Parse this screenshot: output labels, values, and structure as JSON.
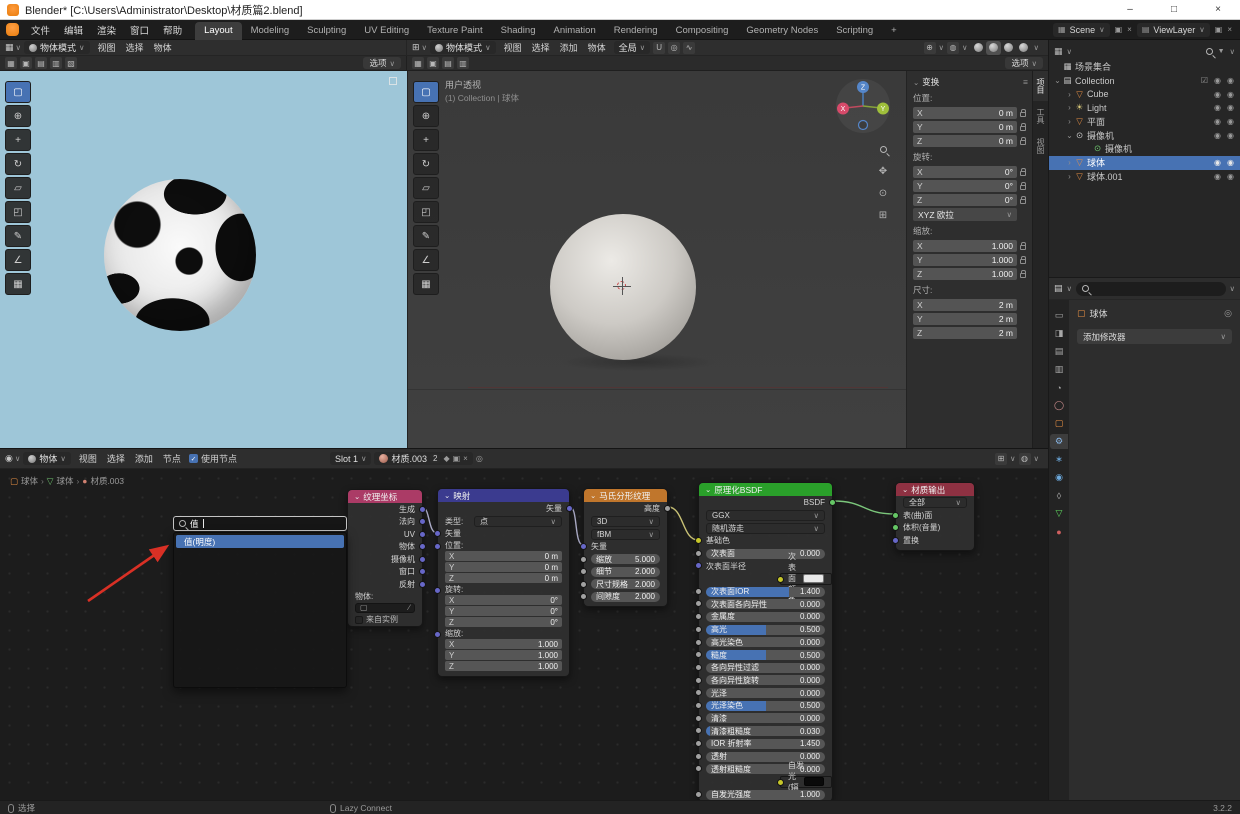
{
  "titlebar": {
    "title": "Blender* [C:\\Users\\Administrator\\Desktop\\材质篇2.blend]",
    "minimize": "–",
    "maximize": "□",
    "close": "×"
  },
  "glyphs": {
    "chevron": "∨",
    "caret": "⌄",
    "collapse": "›",
    "sep": "›",
    "funnel": "▼",
    "menu": "≡",
    "pin": "◎",
    "check": "✓",
    "x": "×",
    "box": "▦",
    "layers": "▤",
    "grid": "⊞",
    "camera": "⊙",
    "hand": "✥",
    "eyedropper": "∕",
    "shield": "◆",
    "copy": "▣",
    "obj": "▢",
    "dot": "●"
  },
  "colors": {
    "accent": "#4772b3",
    "selection": "#4772b3",
    "socket_vector": "#6767c7",
    "socket_color": "#c7c729",
    "socket_float": "#a1a1a1",
    "socket_shader": "#65c765"
  },
  "topbar": {
    "menus": [
      "文件",
      "编辑",
      "渲染",
      "窗口",
      "帮助"
    ],
    "tabs": [
      {
        "label": "Layout",
        "active": true
      },
      {
        "label": "Modeling"
      },
      {
        "label": "Sculpting"
      },
      {
        "label": "UV Editing"
      },
      {
        "label": "Texture Paint"
      },
      {
        "label": "Shading"
      },
      {
        "label": "Animation"
      },
      {
        "label": "Rendering"
      },
      {
        "label": "Compositing"
      },
      {
        "label": "Geometry Nodes"
      },
      {
        "label": "Scripting"
      },
      {
        "label": "+"
      }
    ],
    "scene_label": "Scene",
    "viewlayer_label": "ViewLayer"
  },
  "viewport_left": {
    "mode": "物体模式",
    "menus": [
      "视图",
      "选择",
      "物体"
    ],
    "options": "选项",
    "tools": [
      {
        "g": "▢",
        "active": true
      },
      {
        "g": "⊕"
      },
      {
        "g": "+"
      },
      {
        "g": "↻"
      },
      {
        "g": "▱"
      },
      {
        "g": "◰"
      },
      {
        "g": "✎"
      },
      {
        "g": "∠"
      },
      {
        "g": "▦"
      }
    ]
  },
  "viewport_center": {
    "mode": "物体模式",
    "menus": [
      "视图",
      "选择",
      "添加",
      "物体"
    ],
    "orientation": "全局",
    "options": "选项",
    "view_label": "用户透视",
    "context_label": "(1) Collection | 球体",
    "axis_x": "X",
    "axis_y": "Y",
    "axis_z": "Z",
    "shading": [
      {},
      {
        "active": true
      },
      {},
      {}
    ]
  },
  "npanel": {
    "title": "变换",
    "tabs": [
      {
        "label": "项目",
        "active": true
      },
      {
        "label": "工具"
      },
      {
        "label": "视图"
      }
    ],
    "location": {
      "label": "位置:",
      "rows": [
        {
          "a": "X",
          "v": "0 m"
        },
        {
          "a": "Y",
          "v": "0 m"
        },
        {
          "a": "Z",
          "v": "0 m"
        }
      ]
    },
    "rotation": {
      "label": "旋转:",
      "mode": "XYZ 欧拉",
      "rows": [
        {
          "a": "X",
          "v": "0°"
        },
        {
          "a": "Y",
          "v": "0°"
        },
        {
          "a": "Z",
          "v": "0°"
        }
      ]
    },
    "scale": {
      "label": "缩放:",
      "rows": [
        {
          "a": "X",
          "v": "1.000"
        },
        {
          "a": "Y",
          "v": "1.000"
        },
        {
          "a": "Z",
          "v": "1.000"
        }
      ]
    },
    "dimensions": {
      "label": "尺寸:",
      "rows": [
        {
          "a": "X",
          "v": "2 m"
        },
        {
          "a": "Y",
          "v": "2 m"
        },
        {
          "a": "Z",
          "v": "2 m"
        }
      ]
    }
  },
  "outliner": {
    "rows": [
      {
        "pad": "4px",
        "arrow": "",
        "g": "▦",
        "gc": "#c9c9c9",
        "label": "场景集合",
        "chk": "",
        "eye": "",
        "cam": ""
      },
      {
        "pad": "4px",
        "arrow": "⌄",
        "g": "▤",
        "gc": "#c9c9c9",
        "label": "Collection",
        "chk": "☑",
        "eye": "◉",
        "cam": "◉"
      },
      {
        "pad": "16px",
        "arrow": "›",
        "g": "▽",
        "gc": "#e78f44",
        "label": "Cube",
        "chk": "",
        "eye": "◉",
        "cam": "◉"
      },
      {
        "pad": "16px",
        "arrow": "›",
        "g": "☀",
        "gc": "#d9c97a",
        "label": "Light",
        "chk": "",
        "eye": "◉",
        "cam": "◉"
      },
      {
        "pad": "16px",
        "arrow": "›",
        "g": "▽",
        "gc": "#e78f44",
        "label": "平面",
        "chk": "",
        "eye": "◉",
        "cam": "◉"
      },
      {
        "pad": "16px",
        "arrow": "⌄",
        "g": "⊙",
        "gc": "#c9c9c9",
        "label": "摄像机",
        "chk": "",
        "eye": "◉",
        "cam": "◉"
      },
      {
        "pad": "34px",
        "arrow": "",
        "g": "⊙",
        "gc": "#6fc76f",
        "label": "摄像机",
        "chk": "",
        "eye": "",
        "cam": ""
      },
      {
        "pad": "16px",
        "arrow": "›",
        "g": "▽",
        "gc": "#e78f44",
        "label": "球体",
        "sel": true,
        "chk": "",
        "eye": "◉",
        "cam": "◉"
      },
      {
        "pad": "16px",
        "arrow": "›",
        "g": "▽",
        "gc": "#e78f44",
        "label": "球体.001",
        "chk": "",
        "eye": "◉",
        "cam": "◉"
      }
    ]
  },
  "properties": {
    "search_value": "",
    "breadcrumb_object": "球体",
    "add_modifier": "添加修改器",
    "tabs": [
      {
        "g": "▭",
        "c": "#a8a8a8"
      },
      {
        "g": "◨",
        "c": "#a8a8a8"
      },
      {
        "g": "▤",
        "c": "#a8a8a8"
      },
      {
        "g": "▥",
        "c": "#a8a8a8"
      },
      {
        "g": "◔",
        "c": "#a8a8a8"
      },
      {
        "g": "◯",
        "c": "#cf8f8f"
      },
      {
        "g": "▢",
        "c": "#e78f44"
      },
      {
        "g": "⚙",
        "c": "#8ab8e8",
        "active": true
      },
      {
        "g": "∗",
        "c": "#6ca9dd"
      },
      {
        "g": "◉",
        "c": "#6ca9dd"
      },
      {
        "g": "◊",
        "c": "#a8a8a8"
      },
      {
        "g": "▽",
        "c": "#5fd75f"
      },
      {
        "g": "●",
        "c": "#cf5f5f"
      }
    ]
  },
  "node_editor": {
    "header": {
      "shader_type": "物体",
      "menus": [
        "视图",
        "选择",
        "添加",
        "节点"
      ],
      "use_nodes": "使用节点",
      "slot": "Slot 1",
      "material": "材质.003",
      "users": "2"
    },
    "breadcrumb": [
      {
        "g": "▢",
        "gc": "#e78f44",
        "label": "球体"
      },
      {
        "g": "▽",
        "gc": "#6fc76f",
        "label": "球体"
      },
      {
        "g": "●",
        "gc": "#cf8070",
        "label": "材质.003"
      }
    ],
    "popup": {
      "query": "值",
      "result": "值(明度)"
    },
    "nodes": {
      "texcoord": {
        "title": "纹理坐标",
        "outputs": [
          {
            "label": "生成"
          },
          {
            "label": "法向"
          },
          {
            "label": "UV"
          },
          {
            "label": "物体"
          },
          {
            "label": "摄像机"
          },
          {
            "label": "窗口"
          },
          {
            "label": "反射"
          }
        ],
        "object_label": "物体:",
        "from_instance": "来自实例"
      },
      "mapping": {
        "title": "映射",
        "output": "矢量",
        "type_label": "类型:",
        "type_value": "点",
        "input": "矢量",
        "groups": [
          {
            "label": "位置:",
            "fields": [
              {
                "a": "X",
                "v": "0 m"
              },
              {
                "a": "Y",
                "v": "0 m"
              },
              {
                "a": "Z",
                "v": "0 m"
              }
            ]
          },
          {
            "label": "旋转:",
            "fields": [
              {
                "a": "X",
                "v": "0°"
              },
              {
                "a": "Y",
                "v": "0°"
              },
              {
                "a": "Z",
                "v": "0°"
              }
            ]
          },
          {
            "label": "缩放:",
            "fields": [
              {
                "a": "X",
                "v": "1.000"
              },
              {
                "a": "Y",
                "v": "1.000"
              },
              {
                "a": "Z",
                "v": "1.000"
              }
            ]
          }
        ]
      },
      "musgrave": {
        "title": "马氏分形纹理",
        "output": "高度",
        "dimension": "3D",
        "mode": "fBM",
        "input": "矢量",
        "fields": [
          {
            "label": "缩放",
            "value": "5.000",
            "fill": "0%",
            "sock": "#a1a1a1",
            "type": "slider"
          },
          {
            "label": "细节",
            "value": "2.000",
            "fill": "0%",
            "sock": "#a1a1a1",
            "type": "slider"
          },
          {
            "label": "尺寸规格",
            "value": "2.000",
            "fill": "0%",
            "sock": "#a1a1a1",
            "type": "slider"
          },
          {
            "label": "间隙度",
            "value": "2.000",
            "fill": "0%",
            "sock": "#a1a1a1",
            "type": "slider"
          }
        ]
      },
      "bsdf": {
        "title": "原理化BSDF",
        "output": "BSDF",
        "distribution": "GGX",
        "subsurface_method": "随机游走",
        "rows": [
          {
            "type": "plain",
            "label": "基础色",
            "sock": "#c7c729"
          },
          {
            "type": "slider",
            "label": "次表面",
            "value": "0.000",
            "fill": "0%",
            "sock": "#a1a1a1"
          },
          {
            "type": "plain",
            "label": "次表面半径",
            "sock": "#6767c7"
          },
          {
            "type": "swatch",
            "label": "次表面颜色",
            "swatch": "#e8e8e8",
            "sock": "#c7c729"
          },
          {
            "type": "slider",
            "label": "次表面IOR",
            "value": "1.400",
            "fill": "70%",
            "sock": "#a1a1a1"
          },
          {
            "type": "slider",
            "label": "次表面各向异性",
            "value": "0.000",
            "fill": "0%",
            "sock": "#a1a1a1"
          },
          {
            "type": "slider",
            "label": "金属度",
            "value": "0.000",
            "fill": "0%",
            "sock": "#a1a1a1"
          },
          {
            "type": "slider",
            "label": "高光",
            "value": "0.500",
            "fill": "50%",
            "sock": "#a1a1a1"
          },
          {
            "type": "slider",
            "label": "高光染色",
            "value": "0.000",
            "fill": "0%",
            "sock": "#a1a1a1"
          },
          {
            "type": "slider",
            "label": "糙度",
            "value": "0.500",
            "fill": "50%",
            "sock": "#a1a1a1"
          },
          {
            "type": "slider",
            "label": "各向异性过滤",
            "value": "0.000",
            "fill": "0%",
            "sock": "#a1a1a1"
          },
          {
            "type": "slider",
            "label": "各向异性旋转",
            "value": "0.000",
            "fill": "0%",
            "sock": "#a1a1a1"
          },
          {
            "type": "slider",
            "label": "光泽",
            "value": "0.000",
            "fill": "0%",
            "sock": "#a1a1a1"
          },
          {
            "type": "slider",
            "label": "光泽染色",
            "value": "0.500",
            "fill": "50%",
            "sock": "#a1a1a1"
          },
          {
            "type": "slider",
            "label": "清漆",
            "value": "0.000",
            "fill": "0%",
            "sock": "#a1a1a1"
          },
          {
            "type": "slider",
            "label": "清漆粗糙度",
            "value": "0.030",
            "fill": "3%",
            "sock": "#a1a1a1"
          },
          {
            "type": "slider",
            "label": "IOR 折射率",
            "value": "1.450",
            "fill": "0%",
            "sock": "#a1a1a1"
          },
          {
            "type": "slider",
            "label": "透射",
            "value": "0.000",
            "fill": "0%",
            "sock": "#a1a1a1"
          },
          {
            "type": "slider",
            "label": "透射粗糙度",
            "value": "0.000",
            "fill": "0%",
            "sock": "#a1a1a1"
          },
          {
            "type": "swatch",
            "label": "自发光(辐射)",
            "swatch": "#0a0a0a",
            "sock": "#c7c729"
          },
          {
            "type": "slider",
            "label": "自发光强度",
            "value": "1.000",
            "fill": "0%",
            "sock": "#a1a1a1"
          }
        ]
      },
      "output_node": {
        "title": "材质输出",
        "target": "全部",
        "inputs": [
          {
            "label": "表(曲)面",
            "sock": "#65c765"
          },
          {
            "label": "体积(音量)",
            "sock": "#65c765"
          },
          {
            "label": "置换",
            "sock": "#6767c7"
          }
        ]
      }
    }
  },
  "statusbar": {
    "left": "选择",
    "middle": "Lazy Connect",
    "version": "3.2.2"
  }
}
